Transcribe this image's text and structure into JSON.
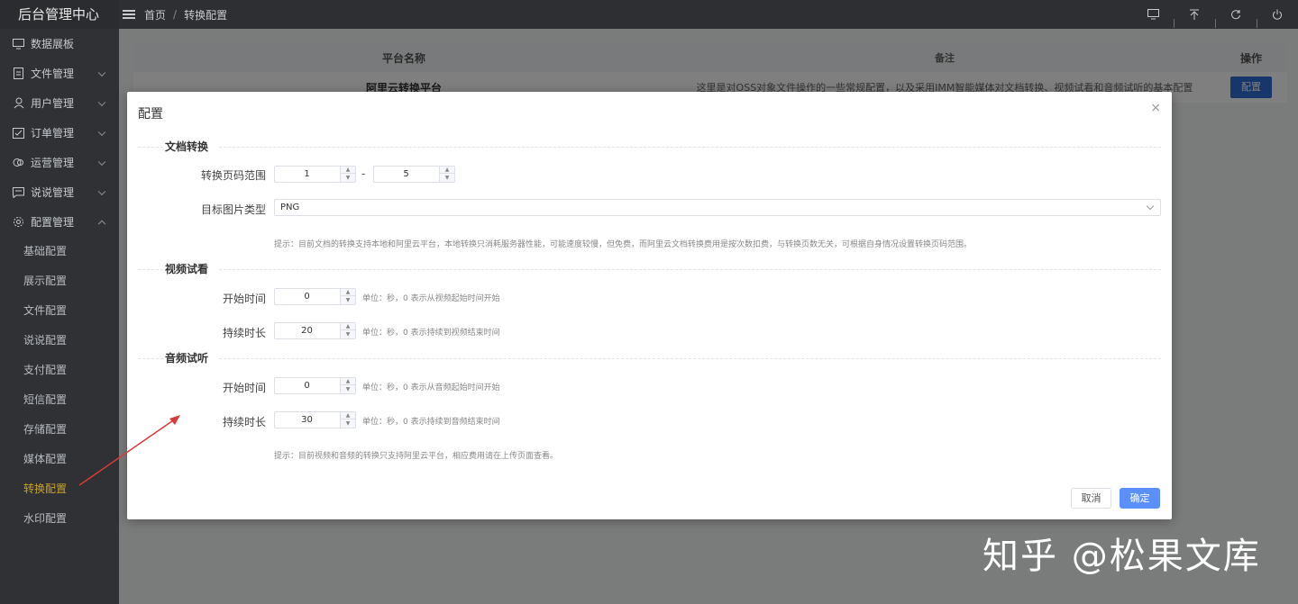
{
  "brand": "后台管理中心",
  "sidebar": {
    "items": [
      {
        "label": "数据展板",
        "icon": "monitor-icon",
        "arrow": false
      },
      {
        "label": "文件管理",
        "icon": "file-icon",
        "arrow": true
      },
      {
        "label": "用户管理",
        "icon": "user-icon",
        "arrow": true
      },
      {
        "label": "订单管理",
        "icon": "order-icon",
        "arrow": true
      },
      {
        "label": "运营管理",
        "icon": "operation-icon",
        "arrow": true
      },
      {
        "label": "说说管理",
        "icon": "message-icon",
        "arrow": true
      },
      {
        "label": "配置管理",
        "icon": "gear-icon",
        "arrow": true,
        "expanded": true
      }
    ],
    "sub_items": [
      "基础配置",
      "展示配置",
      "文件配置",
      "说说配置",
      "支付配置",
      "短信配置",
      "存储配置",
      "媒体配置",
      "转换配置",
      "水印配置"
    ],
    "active_sub": "转换配置"
  },
  "breadcrumb": {
    "home": "首页",
    "sep": "/",
    "current": "转换配置"
  },
  "table": {
    "headers": [
      "平台名称",
      "备注",
      "操作"
    ],
    "rows": [
      {
        "name": "阿里云转换平台",
        "note": "这里是对OSS对象文件操作的一些常规配置，以及采用IMM智能媒体对文档转换、视频试看和音频试听的基本配置",
        "action": "配置"
      }
    ]
  },
  "modal": {
    "title": "配置",
    "close": "×",
    "doc_section": "文档转换",
    "page_range_label": "转换页码范围",
    "page_from": "1",
    "page_dash": "-",
    "page_to": "5",
    "image_type_label": "目标图片类型",
    "image_type_value": "PNG",
    "doc_hint": "提示：目前文档的转换支持本地和阿里云平台，本地转换只消耗服务器性能，可能速度较慢，但免费，而阿里云文档转换费用是按次数扣费，与转换页数无关，可根据自身情况设置转换页码范围。",
    "video_section": "视频试看",
    "video_start_label": "开始时间",
    "video_start_value": "0",
    "video_start_hint": "单位：秒，0 表示从视频起始时间开始",
    "video_duration_label": "持续时长",
    "video_duration_value": "20",
    "video_duration_hint": "单位：秒，0 表示持续到视频结束时间",
    "audio_section": "音频试听",
    "audio_start_label": "开始时间",
    "audio_start_value": "0",
    "audio_start_hint": "单位：秒，0 表示从音频起始时间开始",
    "audio_duration_label": "持续时长",
    "audio_duration_value": "30",
    "audio_duration_hint": "单位：秒，0 表示持续到音频结束时间",
    "media_hint": "提示：目前视频和音频的转换只支持阿里云平台，相应费用请在上传页面查看。",
    "cancel": "取消",
    "ok": "确定"
  },
  "watermark": "知乎 @松果文库",
  "colors": {
    "sidebar_bg": "#2f3134",
    "active": "#c9a227",
    "primary": "#5b8ff9"
  }
}
